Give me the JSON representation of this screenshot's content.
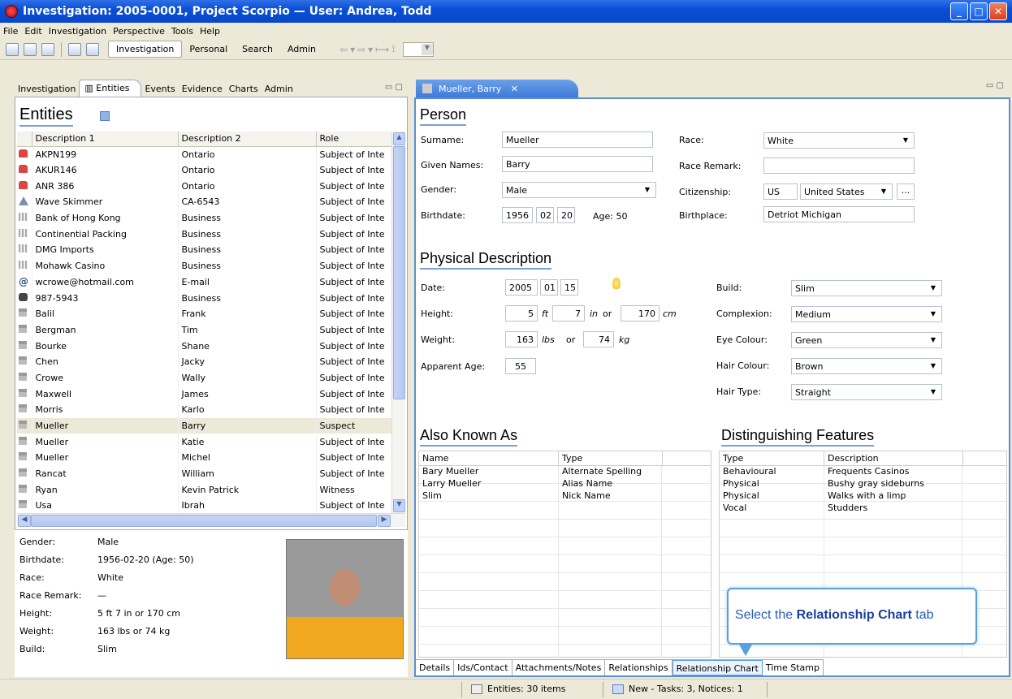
{
  "window": {
    "title": "Investigation: 2005-0001, Project Scorpio — User: Andrea, Todd",
    "controls": [
      "minimize",
      "maximize",
      "close"
    ]
  },
  "menu": [
    "File",
    "Edit",
    "Investigation",
    "Perspective",
    "Tools",
    "Help"
  ],
  "perspectives": [
    {
      "label": "Investigation",
      "active": true
    },
    {
      "label": "Personal",
      "active": false
    },
    {
      "label": "Search",
      "active": false
    },
    {
      "label": "Admin",
      "active": false
    }
  ],
  "left_tabs": [
    "Investigation",
    "Entities",
    "Events",
    "Evidence",
    "Charts",
    "Admin"
  ],
  "entities": {
    "title": "Entities",
    "columns": [
      "Description 1",
      "Description 2",
      "Role"
    ],
    "rows": [
      {
        "icon": "vehicle-icon",
        "d1": "AKPN199",
        "d2": "Ontario",
        "role": "Subject of Inte"
      },
      {
        "icon": "vehicle-icon",
        "d1": "AKUR146",
        "d2": "Ontario",
        "role": "Subject of Inte"
      },
      {
        "icon": "vehicle-icon",
        "d1": "ANR 386",
        "d2": "Ontario",
        "role": "Subject of Inte"
      },
      {
        "icon": "vessel-icon",
        "d1": "Wave Skimmer",
        "d2": "CA-6543",
        "role": "Subject of Inte"
      },
      {
        "icon": "organization-icon",
        "d1": "Bank of Hong Kong",
        "d2": "Business",
        "role": "Subject of Inte"
      },
      {
        "icon": "organization-icon",
        "d1": "Continential Packing",
        "d2": "Business",
        "role": "Subject of Inte"
      },
      {
        "icon": "organization-icon",
        "d1": "DMG Imports",
        "d2": "Business",
        "role": "Subject of Inte"
      },
      {
        "icon": "organization-icon",
        "d1": "Mohawk Casino",
        "d2": "Business",
        "role": "Subject of Inte"
      },
      {
        "icon": "email-icon",
        "d1": "wcrowe@hotmail.com",
        "d2": "E-mail",
        "role": "Subject of Inte"
      },
      {
        "icon": "phone-icon",
        "d1": "987-5943",
        "d2": "Business",
        "role": "Subject of Inte"
      },
      {
        "icon": "person-icon",
        "d1": "Balil",
        "d2": "Frank",
        "role": "Subject of Inte"
      },
      {
        "icon": "person-icon",
        "d1": "Bergman",
        "d2": "Tim",
        "role": "Subject of Inte"
      },
      {
        "icon": "person-icon",
        "d1": "Bourke",
        "d2": "Shane",
        "role": "Subject of Inte"
      },
      {
        "icon": "person-icon",
        "d1": "Chen",
        "d2": "Jacky",
        "role": "Subject of Inte"
      },
      {
        "icon": "person-icon",
        "d1": "Crowe",
        "d2": "Wally",
        "role": "Subject of Inte"
      },
      {
        "icon": "person-icon",
        "d1": "Maxwell",
        "d2": "James",
        "role": "Subject of Inte"
      },
      {
        "icon": "person-icon",
        "d1": "Morris",
        "d2": "Karlo",
        "role": "Subject of Inte"
      },
      {
        "icon": "person-icon",
        "d1": "Mueller",
        "d2": "Barry",
        "role": "Suspect",
        "selected": true
      },
      {
        "icon": "person-icon",
        "d1": "Mueller",
        "d2": "Katie",
        "role": "Subject of Inte"
      },
      {
        "icon": "person-icon",
        "d1": "Mueller",
        "d2": "Michel",
        "role": "Subject of Inte"
      },
      {
        "icon": "person-icon",
        "d1": "Rancat",
        "d2": "William",
        "role": "Subject of Inte"
      },
      {
        "icon": "person-icon",
        "d1": "Ryan",
        "d2": "Kevin Patrick",
        "role": "Witness"
      },
      {
        "icon": "person-icon",
        "d1": "Usa",
        "d2": "Ibrah",
        "role": "Subject of Inte"
      }
    ]
  },
  "summary": [
    {
      "k": "Gender:",
      "v": "Male"
    },
    {
      "k": "Birthdate:",
      "v": "1956-02-20  (Age: 50)"
    },
    {
      "k": "Race:",
      "v": "White"
    },
    {
      "k": "Race Remark:",
      "v": "—"
    },
    {
      "k": "Height:",
      "v": "5 ft 7 in or 170 cm"
    },
    {
      "k": "Weight:",
      "v": "163 lbs or 74 kg"
    },
    {
      "k": "Build:",
      "v": "Slim"
    }
  ],
  "editor_tab": {
    "label": "Mueller, Barry"
  },
  "person": {
    "section": "Person",
    "surname_label": "Surname:",
    "surname": "Mueller",
    "given_label": "Given Names:",
    "given": "Barry",
    "gender_label": "Gender:",
    "gender": "Male",
    "birth_label": "Birthdate:",
    "birth_y": "1956",
    "birth_m": "02",
    "birth_d": "20",
    "age": "Age: 50",
    "race_label": "Race:",
    "race": "White",
    "race_remark_label": "Race Remark:",
    "race_remark": "",
    "citizenship_label": "Citizenship:",
    "citizenship_code": "US",
    "citizenship": "United States",
    "birthplace_label": "Birthplace:",
    "birthplace": "Detriot Michigan"
  },
  "physical": {
    "section": "Physical Description",
    "date_label": "Date:",
    "date_y": "2005",
    "date_m": "01",
    "date_d": "15",
    "height_label": "Height:",
    "ft": "5",
    "ft_unit": "ft",
    "in": "7",
    "in_unit": "in",
    "or1": "or",
    "cm": "170",
    "cm_unit": "cm",
    "weight_label": "Weight:",
    "lbs": "163",
    "lbs_unit": "lbs",
    "or2": "or",
    "kg": "74",
    "kg_unit": "kg",
    "age_label": "Apparent Age:",
    "age": "55",
    "build_label": "Build:",
    "build": "Slim",
    "complexion_label": "Complexion:",
    "complexion": "Medium",
    "eye_label": "Eye Colour:",
    "eye": "Green",
    "hair_label": "Hair Colour:",
    "hair": "Brown",
    "hairtype_label": "Hair Type:",
    "hairtype": "Straight"
  },
  "aka": {
    "section": "Also Known As",
    "columns": [
      "Name",
      "Type"
    ],
    "rows": [
      {
        "name": "Bary Mueller",
        "type": "Alternate Spelling"
      },
      {
        "name": "Larry Mueller",
        "type": "Alias Name"
      },
      {
        "name": "Slim",
        "type": "Nick Name"
      }
    ]
  },
  "features": {
    "section": "Distinguishing Features",
    "columns": [
      "Type",
      "Description"
    ],
    "rows": [
      {
        "type": "Behavioural",
        "desc": "Frequents Casinos"
      },
      {
        "type": "Physical",
        "desc": "Bushy gray sideburns"
      },
      {
        "type": "Physical",
        "desc": "Walks with a limp"
      },
      {
        "type": "Vocal",
        "desc": "Studders"
      }
    ]
  },
  "callout": {
    "pre": "Select the ",
    "bold": "Relationship Chart",
    "post": " tab"
  },
  "bottom_tabs": [
    "Details",
    "Ids/Contact",
    "Attachments/Notes",
    "Relationships",
    "Relationship Chart",
    "Time Stamp"
  ],
  "status": {
    "entities": "Entities: 30 items",
    "tasks": "New - Tasks: 3, Notices: 1"
  }
}
